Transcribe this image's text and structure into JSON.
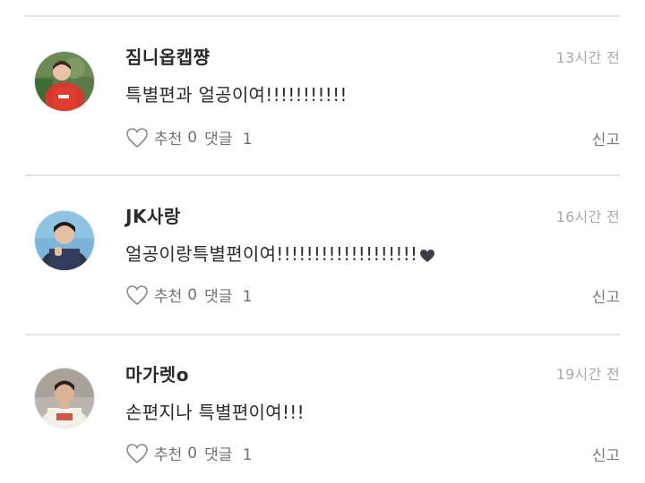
{
  "comments": [
    {
      "username": "짐니옵캡쨩",
      "time": "13시간 전",
      "text": "특별편과 얼공이여!!!!!!!!!!!",
      "trailing_emoji": "",
      "like_label": "추천",
      "like_count": "0",
      "reply_label": "댓글",
      "reply_count": "1",
      "report_label": "신고",
      "avatar_icon": "profile-photo-red-shirt"
    },
    {
      "username": "JK사랑",
      "time": "16시간 전",
      "text": "얼공이랑특별편이여!!!!!!!!!!!!!!!!!!!",
      "trailing_emoji": "black-heart",
      "like_label": "추천",
      "like_count": "0",
      "reply_label": "댓글",
      "reply_count": "1",
      "report_label": "신고",
      "avatar_icon": "profile-photo-blue-background"
    },
    {
      "username": "마가렛o",
      "time": "19시간 전",
      "text": "손편지나 특별편이여!!!",
      "trailing_emoji": "",
      "like_label": "추천",
      "like_count": "0",
      "reply_label": "댓글",
      "reply_count": "1",
      "report_label": "신고",
      "avatar_icon": "profile-photo-white-shirt"
    }
  ],
  "colors": {
    "divider": "#e2e2e2",
    "muted_text": "#a9a9a9",
    "action_text": "#707070",
    "emoji_heart": "#3a3f47"
  }
}
